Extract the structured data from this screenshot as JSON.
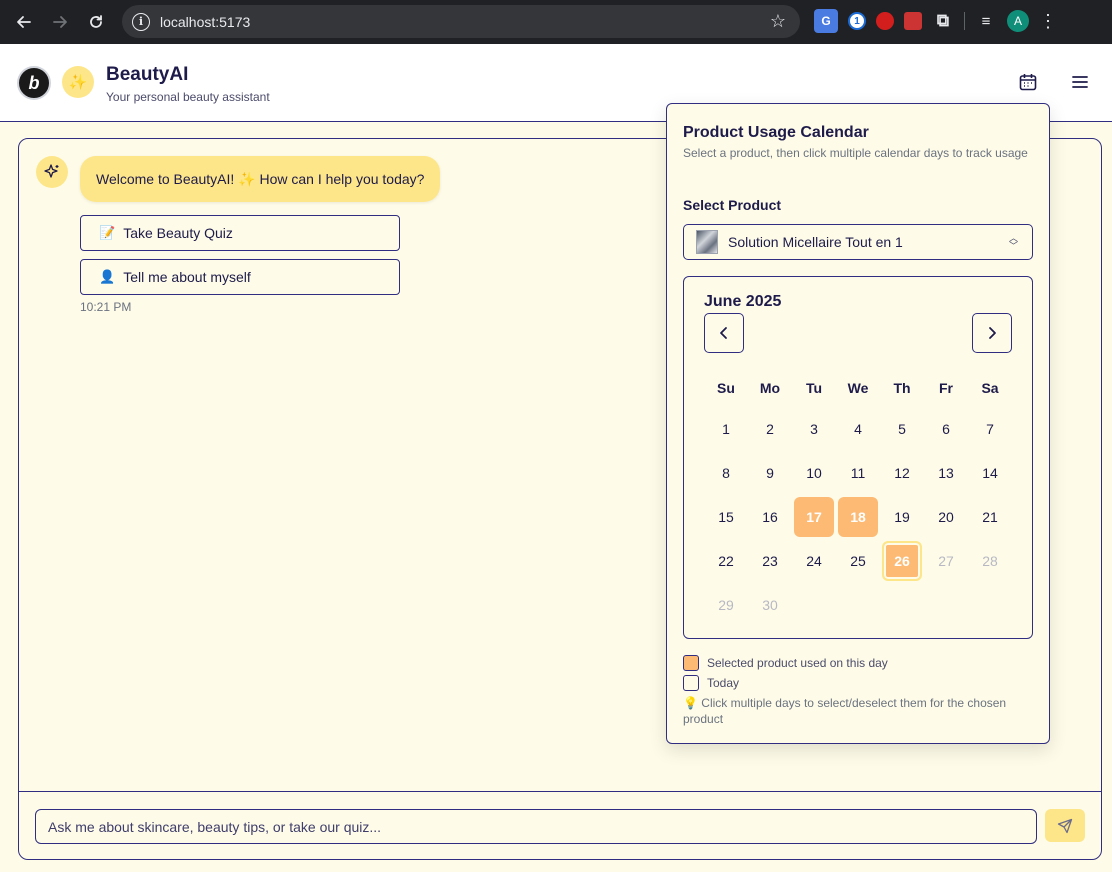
{
  "browser": {
    "url": "localhost:5173",
    "profile_initial": "A",
    "icons": [
      "back-arrow-icon",
      "forward-arrow-icon",
      "reload-icon",
      "site-info-icon",
      "bookmark-star-icon",
      "translate-extension-icon",
      "password-extension-icon",
      "block-extension-icon",
      "bug-extension-icon",
      "extensions-puzzle-icon",
      "media-control-icon",
      "more-menu-icon"
    ]
  },
  "header": {
    "title": "BeautyAI",
    "subtitle": "Your personal beauty assistant",
    "logo_letter": "b",
    "badge_icon": "sparkle-icon"
  },
  "chat": {
    "welcome_message": "Welcome to BeautyAI! ✨ How can I help you today?",
    "quiz_button": {
      "emoji": "📝",
      "label": "Take Beauty Quiz"
    },
    "about_button": {
      "emoji": "👤",
      "label": "Tell me about myself"
    },
    "timestamp": "10:21 PM",
    "input_placeholder": "Ask me about skincare, beauty tips, or take our quiz..."
  },
  "calendar_popover": {
    "title": "Product Usage Calendar",
    "description": "Select a product, then click multiple calendar days to track usage",
    "select_label": "Select Product",
    "selected_product": "Solution Micellaire Tout en 1",
    "month": "June 2025",
    "weekdays": [
      "Su",
      "Mo",
      "Tu",
      "We",
      "Th",
      "Fr",
      "Sa"
    ],
    "weeks": [
      [
        1,
        2,
        3,
        4,
        5,
        6,
        7
      ],
      [
        8,
        9,
        10,
        11,
        12,
        13,
        14
      ],
      [
        15,
        16,
        17,
        18,
        19,
        20,
        21
      ],
      [
        22,
        23,
        24,
        25,
        26,
        27,
        28
      ],
      [
        29,
        30
      ]
    ],
    "used_days": [
      17,
      18,
      26
    ],
    "today": 26,
    "disabled_days": [
      27,
      28,
      29,
      30
    ],
    "legend_used": "Selected product used on this day",
    "legend_today": "Today",
    "hint": "💡 Click multiple days to select/deselect them for the chosen product"
  },
  "colors": {
    "accent_yellow": "#fde68a",
    "used_orange": "#fdba74",
    "border_navy": "#312e81",
    "background": "#fefce8"
  }
}
